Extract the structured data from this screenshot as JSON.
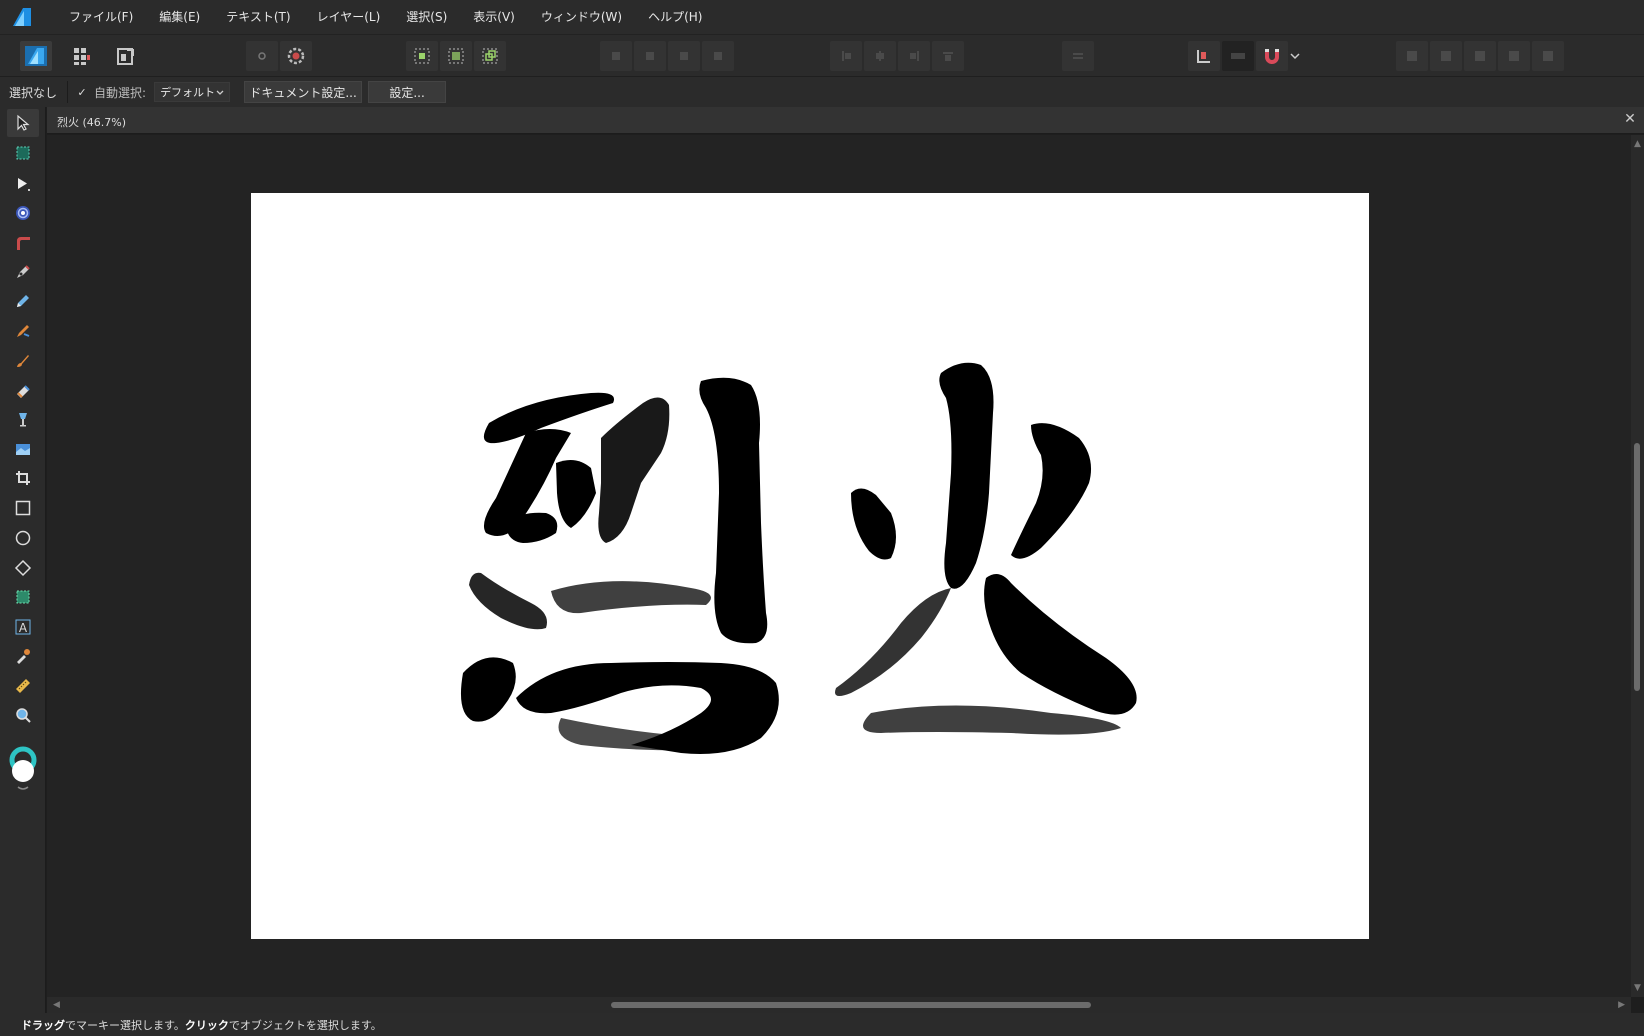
{
  "menu": {
    "items": [
      "ファイル(F)",
      "編集(E)",
      "テキスト(T)",
      "レイヤー(L)",
      "選択(S)",
      "表示(V)",
      "ウィンドウ(W)",
      "ヘルプ(H)"
    ]
  },
  "context": {
    "selection_label": "選択なし",
    "auto_select_label": "自動選択:",
    "auto_select_checked": true,
    "auto_select_value": "デフォルト",
    "doc_settings_button": "ドキュメント設定...",
    "settings_button": "設定..."
  },
  "document": {
    "tab_title": "烈火 (46.7%)",
    "artwork_text": "烈火"
  },
  "status": {
    "drag_word": "ドラッグ",
    "drag_desc": "でマーキー選択します。",
    "click_word": "クリック",
    "click_desc": "でオブジェクトを選択します。"
  },
  "colors": {
    "accent_blue": "#2f9de8",
    "canvas_bg": "#232323",
    "ui_bg": "#2b2b2b"
  },
  "icons": {
    "toolbar": [
      "designer-persona-icon",
      "pixel-persona-icon",
      "export-persona-icon",
      "snapping-icon",
      "gear-icon",
      "select-all-icon",
      "select-none-icon",
      "select-layer-icon",
      "arrange-icon",
      "align-icon",
      "distribute-icon",
      "snapping-magnet-icon"
    ],
    "tools": [
      "move-tool-icon",
      "artboard-tool-icon",
      "node-tool-icon",
      "contour-tool-icon",
      "corner-tool-icon",
      "pen-tool-icon",
      "pencil-tool-icon",
      "vector-brush-tool-icon",
      "paint-brush-tool-icon",
      "fill-tool-icon",
      "transparency-tool-icon",
      "place-image-tool-icon",
      "crop-tool-icon",
      "rectangle-tool-icon",
      "ellipse-tool-icon",
      "shape-tool-icon",
      "frame-text-tool-icon",
      "artistic-text-tool-icon",
      "color-picker-tool-icon",
      "measure-tool-icon",
      "zoom-tool-icon"
    ]
  }
}
